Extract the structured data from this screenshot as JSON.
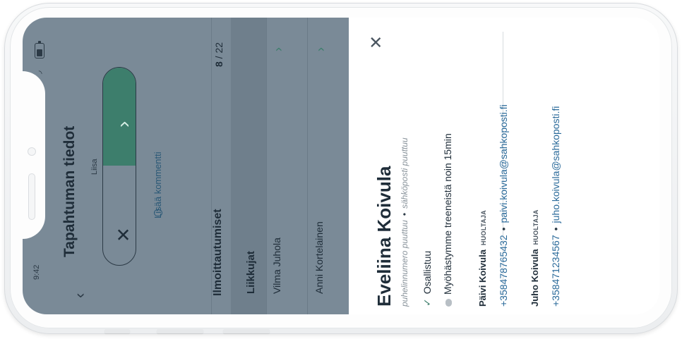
{
  "status_bar": {
    "time": "9:42",
    "wifi_icon": "wifi-icon",
    "battery_icon": "battery-icon"
  },
  "header": {
    "back_icon": "chevron-left-icon",
    "title": "Tapahtuman tiedot",
    "subtitle": "Liisa"
  },
  "attendance_toggle": {
    "yes_icon": "chevron-icon",
    "no_icon": "close-icon",
    "yes_color": "#3d7e6c"
  },
  "comment": {
    "icon": "speech-bubble-icon",
    "label": "Lisää kommentti"
  },
  "registrations": {
    "title": "Ilmoittautumiset",
    "count": "8",
    "total": "/ 22"
  },
  "group": {
    "label": "Liikkujat"
  },
  "people": [
    {
      "name": "Vilma Juhola"
    },
    {
      "name": "Anni Kortelainen"
    }
  ],
  "detail": {
    "close_icon": "close-icon",
    "name": "Eveliina Koivula",
    "phone": "puhelinnumero puuttuu",
    "email": "sähköposti puuttuu",
    "status": "Osallistuu",
    "comment": "Myöhästymme treeneistä noin 15min",
    "guardians": [
      {
        "name": "Päivi Koivula",
        "role": "HUOLTAJA",
        "phone": "+358478765432",
        "email": "paivi.koivula@sahkoposti.fi"
      },
      {
        "name": "Juho Koivula",
        "role": "HUOLTAJA",
        "phone": "+358471234567",
        "email": "juho.koivula@sahkoposti.fi"
      }
    ]
  }
}
